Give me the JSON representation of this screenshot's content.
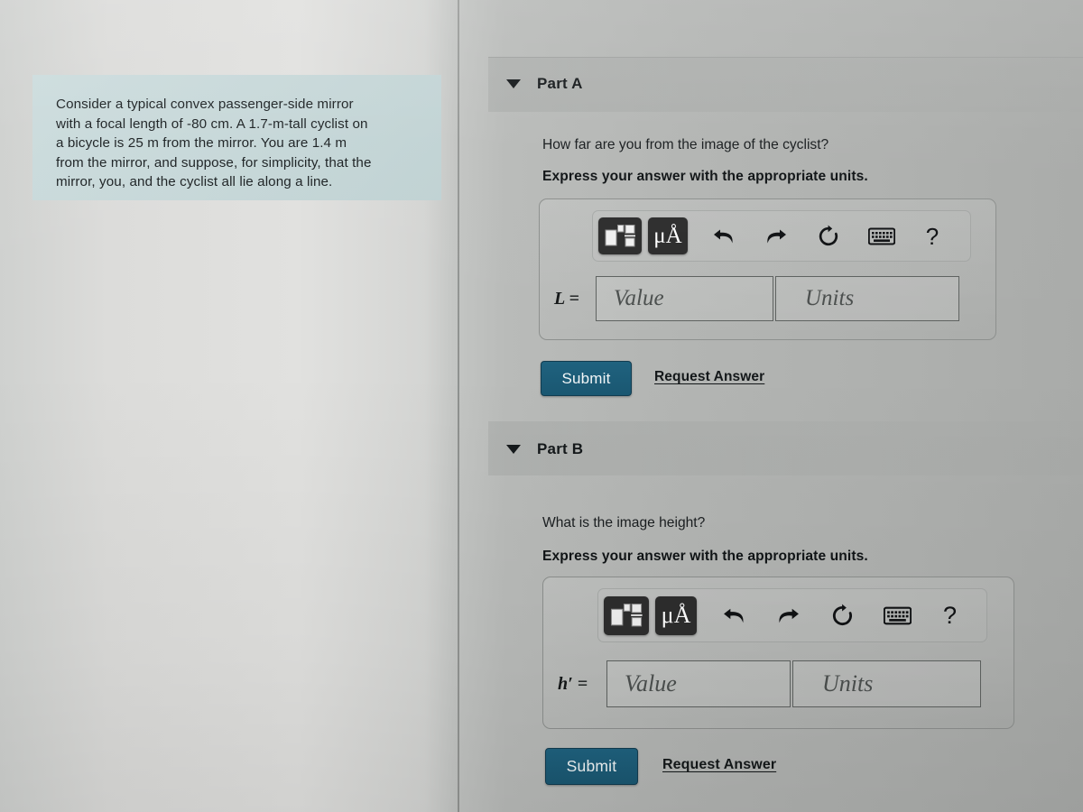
{
  "problem": {
    "statement": "Consider a typical convex passenger-side mirror\nwith a focal length of -80 cm. A 1.7-m-tall cyclist on\na bicycle is 25 m from the mirror. You are 1.4 m\nfrom the mirror, and suppose, for simplicity, that the\nmirror, you, and the cyclist all lie along a line."
  },
  "colors": {
    "problem_box_bg": "#c6d7d8",
    "submit_bg": "#1b5d7a",
    "toolbar_button_dark": "#2d2d2d",
    "page_bg": "#d6d6d4"
  },
  "parts": [
    {
      "title": "Part A",
      "caret": "caret-down-icon",
      "question": "How far are you from the image of the cyclist?",
      "express": "Express your answer with the appropriate units.",
      "toolbar": {
        "math_template_label": "math-template",
        "units_label": "μÅ",
        "undo_label": "undo",
        "redo_label": "redo",
        "reset_label": "reset",
        "keyboard_label": "keyboard",
        "help_label": "?"
      },
      "variable_label": "L =",
      "value_placeholder": "Value",
      "units_placeholder": "Units",
      "value_text": "",
      "units_text": "",
      "submit_label": "Submit",
      "request_label": "Request Answer"
    },
    {
      "title": "Part B",
      "caret": "caret-down-icon",
      "question": "What is the image height?",
      "express": "Express your answer with the appropriate units.",
      "toolbar": {
        "math_template_label": "math-template",
        "units_label": "μÅ",
        "undo_label": "undo",
        "redo_label": "redo",
        "reset_label": "reset",
        "keyboard_label": "keyboard",
        "help_label": "?"
      },
      "variable_label": "h′ =",
      "value_placeholder": "Value",
      "units_placeholder": "Units",
      "value_text": "",
      "units_text": "",
      "submit_label": "Submit",
      "request_label": "Request Answer"
    }
  ]
}
